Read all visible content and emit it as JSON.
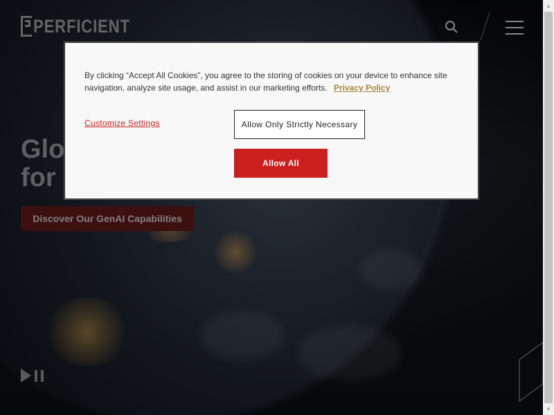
{
  "header": {
    "logo_text": "PERFICIENT",
    "icons": [
      "search-icon",
      "menu-icon"
    ]
  },
  "hero": {
    "title_line1": "Glo",
    "title_line2": "for t",
    "cta_label": "Discover Our GenAI Capabilities"
  },
  "media": {
    "control_icon": "play-pause-icon"
  },
  "cookie_dialog": {
    "text": "By clicking “Accept All Cookies”, you agree to the storing of cookies on your device to enhance site navigation, analyze site usage, and assist in our marketing efforts.",
    "privacy_link": "Privacy Policy",
    "customize_label": "Customize Settings",
    "necessary_label": "Allow Only Strictly Necessary",
    "allow_all_label": "Allow All"
  },
  "colors": {
    "accent_red": "#cc1f1f",
    "link_gold": "#a7853f",
    "cta_bg": "#5e1a1a"
  }
}
